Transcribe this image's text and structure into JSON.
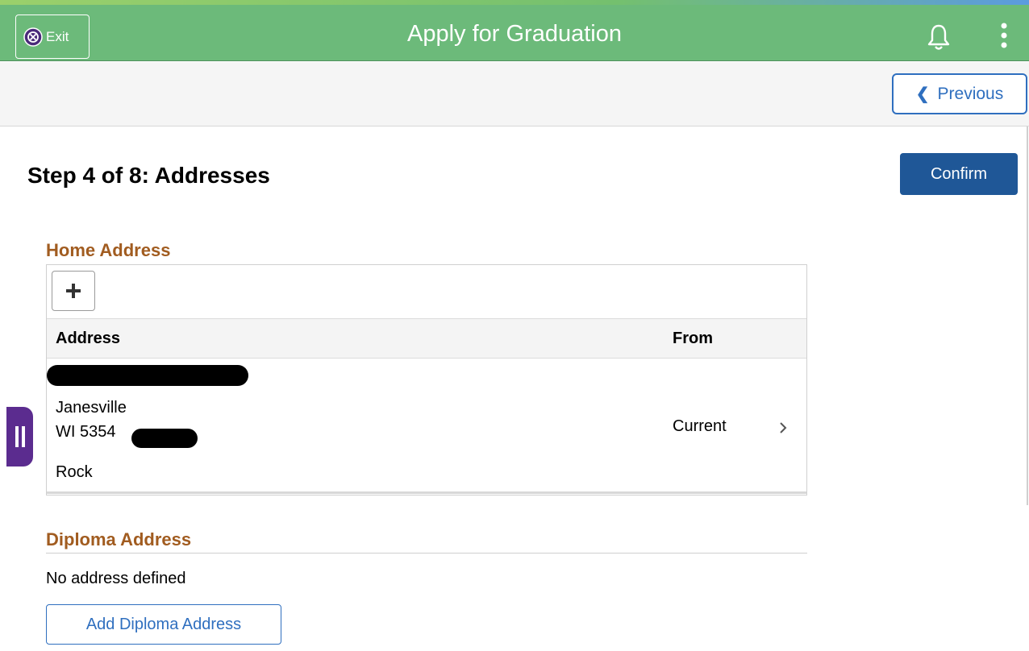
{
  "header": {
    "title": "Apply for Graduation",
    "exit_label": "Exit",
    "icons": {
      "exit": "exit-circle-icon",
      "notifications": "bell-icon",
      "menu": "kebab-menu-icon"
    },
    "colors": {
      "banner": "#6cba7a",
      "accent_blue": "#2f6fbf",
      "primary_button": "#1f5797",
      "section_title": "#a15c20",
      "side_handle": "#5b2c8f"
    }
  },
  "nav": {
    "previous_label": "Previous"
  },
  "page": {
    "title": "Step 4 of 8: Addresses",
    "confirm_label": "Confirm"
  },
  "home_address": {
    "title": "Home Address",
    "add_icon": "plus-icon",
    "columns": {
      "address": "Address",
      "from": "From"
    },
    "rows": [
      {
        "city": "Janesville",
        "state_zip": "WI 5354",
        "county": "Rock",
        "from": "Current"
      }
    ]
  },
  "diploma_address": {
    "title": "Diploma Address",
    "empty_text": "No address defined",
    "add_label": "Add Diploma Address"
  }
}
